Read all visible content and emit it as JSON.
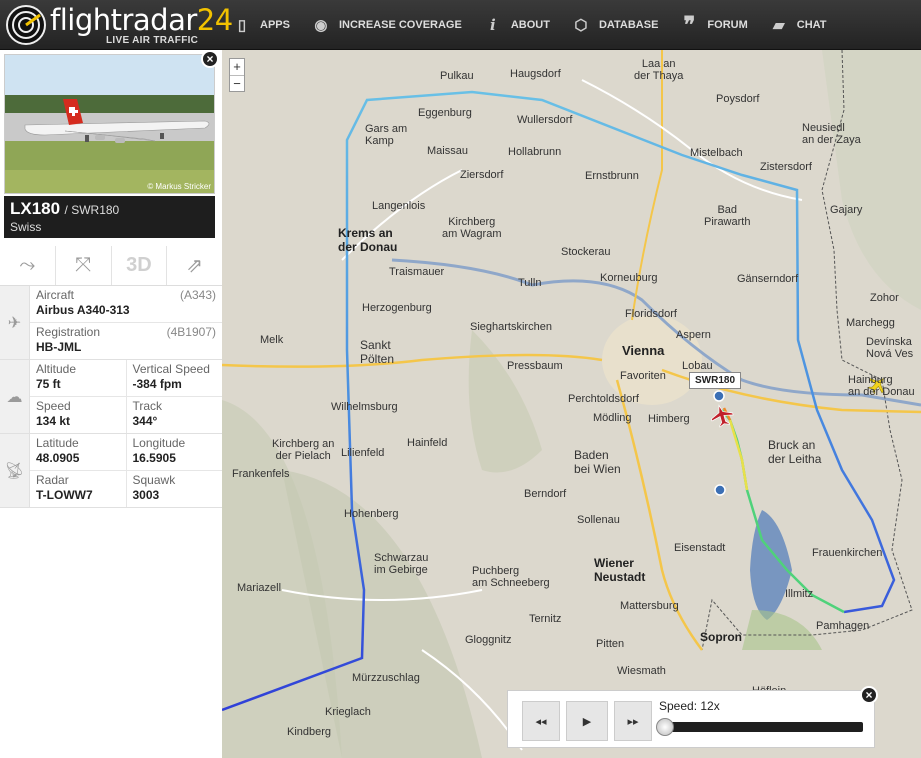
{
  "brand": {
    "name_part1": "flightradar",
    "name_part2": "24",
    "tagline": "LIVE AIR TRAFFIC"
  },
  "nav": [
    {
      "label": "APPS",
      "icon": "phone-icon"
    },
    {
      "label": "INCREASE COVERAGE",
      "icon": "eye-icon"
    },
    {
      "label": "ABOUT",
      "icon": "info-icon"
    },
    {
      "label": "DATABASE",
      "icon": "database-icon"
    },
    {
      "label": "FORUM",
      "icon": "quote-icon"
    },
    {
      "label": "CHAT",
      "icon": "chat-icon"
    }
  ],
  "flight": {
    "photo_credit": "© Markus Stricker",
    "flight_number": "LX180",
    "callsign": "/ SWR180",
    "airline": "Swiss"
  },
  "actions": [
    {
      "name": "route-button",
      "icon": "route-icon"
    },
    {
      "name": "fit-view-button",
      "icon": "shrink-icon"
    },
    {
      "name": "3d-view-button",
      "label": "3D"
    },
    {
      "name": "share-button",
      "icon": "share-icon"
    }
  ],
  "details": {
    "aircraft_label": "Aircraft",
    "aircraft_code": "(A343)",
    "aircraft_value": "Airbus A340-313",
    "registration_label": "Registration",
    "registration_code": "(4B1907)",
    "registration_value": "HB-JML",
    "altitude_label": "Altitude",
    "altitude_value": "75 ft",
    "vspeed_label": "Vertical Speed",
    "vspeed_value": "-384 fpm",
    "speed_label": "Speed",
    "speed_value": "134 kt",
    "track_label": "Track",
    "track_value": "344°",
    "lat_label": "Latitude",
    "lat_value": "48.0905",
    "lon_label": "Longitude",
    "lon_value": "16.5905",
    "radar_label": "Radar",
    "radar_value": "T-LOWW7",
    "squawk_label": "Squawk",
    "squawk_value": "3003"
  },
  "map": {
    "zoom_in": "+",
    "zoom_out": "−",
    "flight_tag": "SWR180",
    "labels": {
      "vienna": "Vienna",
      "pulkau": "Pulkau",
      "haugsdorf": "Haugsdorf",
      "laa": "Laa an\nder Thaya",
      "poysdorf": "Poysdorf",
      "eggenburg": "Eggenburg",
      "wullersdorf": "Wullersdorf",
      "hollabrunn": "Hollabrunn",
      "mistelbach": "Mistelbach",
      "zistersdorf": "Zistersdorf",
      "gars": "Gars am\nKamp",
      "maissau": "Maissau",
      "ziersdorf": "Ziersdorf",
      "ernstbrunn": "Ernstbrunn",
      "langenlois": "Langenlois",
      "krems": "Krems an\nder Donau",
      "kirchberg": "Kirchberg\nam Wagram",
      "stockerau": "Stockerau",
      "bad_pirawarth": "Bad\nPirawarth",
      "gansendorf": "Gänserndorf",
      "traismauer": "Traismauer",
      "tulln": "Tulln",
      "korneuburg": "Korneuburg",
      "floridsdorf": "Floridsdorf",
      "herzogenburg": "Herzogenburg",
      "sieghartskirchen": "Sieghartskirchen",
      "melk": "Melk",
      "sankt_polten": "Sankt\nPölten",
      "pressbaum": "Pressbaum",
      "favoriten": "Favoriten",
      "perchtoldsdorf": "Perchtoldsdorf",
      "lobau": "Lobau",
      "wilhelmsburg": "Wilhelmsburg",
      "modling": "Mödling",
      "himberg": "Himberg",
      "hainfeld": "Hainfeld",
      "lilienfeld": "Lilienfeld",
      "baden": "Baden\nbei Wien",
      "bruck": "Bruck an\nder Leitha",
      "kirchberg_pielach": "Kirchberg an\nder Pielach",
      "frankenfels": "Frankenfels",
      "berndorf": "Berndorf",
      "hohenberg": "Hohenberg",
      "sollenau": "Sollenau",
      "eisenstadt": "Eisenstadt",
      "frauenkirchen": "Frauenkirchen",
      "schwarzau": "Schwarzau\nim Gebirge",
      "puchberg": "Puchberg\nam Schneeberg",
      "wiener_neustadt": "Wiener\nNeustadt",
      "mariazell": "Mariazell",
      "mattersburg": "Mattersburg",
      "ternitz": "Ternitz",
      "pitten": "Pitten",
      "illmitz": "Illmitz",
      "pamhagen": "Pamhagen",
      "gloggnitz": "Gloggnitz",
      "sopron": "Sopron",
      "murzzuschlag": "Mürzzuschlag",
      "wiesmath": "Wiesmath",
      "krieglach": "Krieglach",
      "kindberg": "Kindberg",
      "gajary": "Gajary",
      "marchegg": "Marchegg",
      "devinska": "Devínska\nNová Ves",
      "hainburg": "Hainburg\nan der Donau",
      "neusiedl": "Neusiedl\nan der Zaya",
      "zohor": "Zohor",
      "aspern": "Aspern",
      "hostel": "Höflein"
    }
  },
  "playback": {
    "speed_label": "Speed: 12x",
    "rewind": "◂◂",
    "play": "▶",
    "forward": "▸▸"
  }
}
